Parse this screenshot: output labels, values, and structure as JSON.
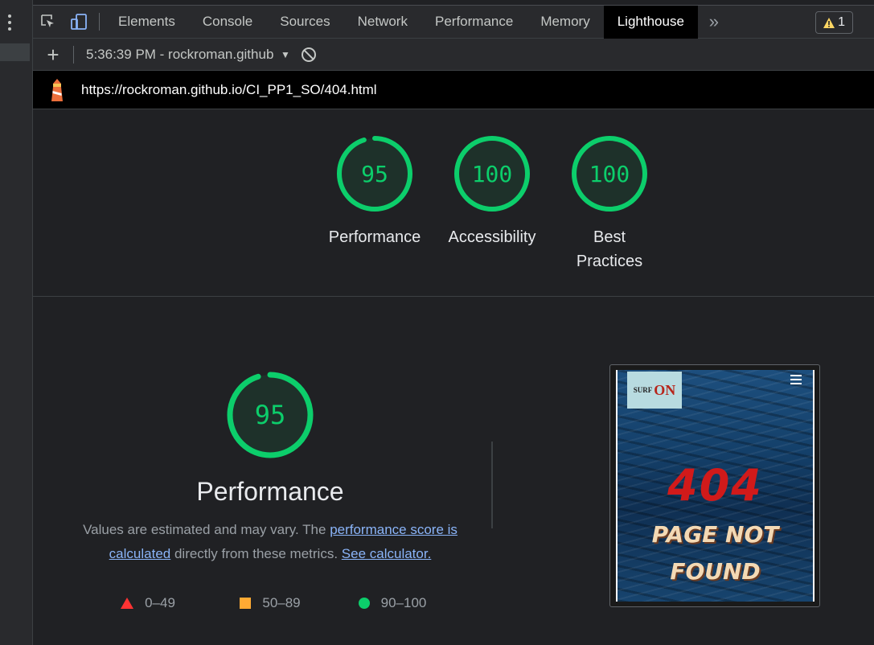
{
  "devtools": {
    "tabs": [
      "Elements",
      "Console",
      "Sources",
      "Network",
      "Performance",
      "Memory",
      "Lighthouse"
    ],
    "active_tab": "Lighthouse",
    "warning_count": "1"
  },
  "lighthouse_toolbar": {
    "report_label": "5:36:39 PM - rockroman.github"
  },
  "report": {
    "url": "https://rockroman.github.io/CI_PP1_SO/404.html",
    "gauges": [
      {
        "score": "95",
        "label": "Performance",
        "value": 95
      },
      {
        "score": "100",
        "label": "Accessibility",
        "value": 100
      },
      {
        "score": "100",
        "label": "Best Practices",
        "value": 100
      }
    ],
    "performance": {
      "score": "95",
      "value": 95,
      "title": "Performance",
      "desc_prefix": "Values are estimated and may vary. The ",
      "link1": "performance score is calculated",
      "desc_mid": " directly from these metrics. ",
      "link2": "See calculator."
    },
    "legend": [
      {
        "shape": "triangle",
        "range": "0–49",
        "color": "#ff3333"
      },
      {
        "shape": "square",
        "range": "50–89",
        "color": "#ffaa33"
      },
      {
        "shape": "circle",
        "range": "90–100",
        "color": "#0cce6b"
      }
    ],
    "screenshot": {
      "brand_small": "SURF",
      "brand_big": "ON",
      "heading": "404",
      "subheading_line1": "PAGE NOT",
      "subheading_line2": "FOUND"
    }
  },
  "colors": {
    "pass": "#0cce6b",
    "average": "#ffaa33",
    "fail": "#ff3333",
    "link": "#8ab4f8"
  }
}
